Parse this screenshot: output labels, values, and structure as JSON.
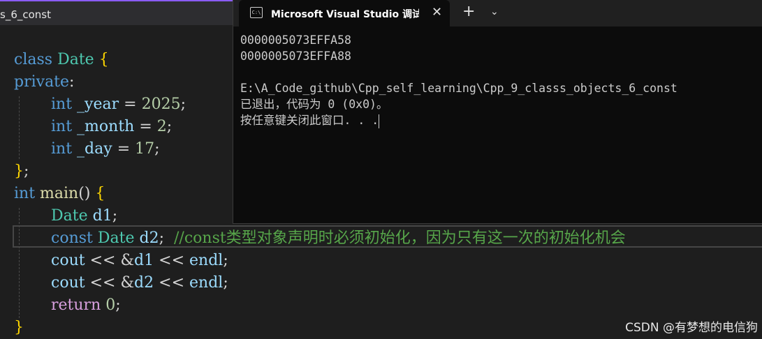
{
  "editor": {
    "tab_label": "s_6_const",
    "code": {
      "l1": {
        "kw": "class",
        "type": "Date",
        "brace": "{"
      },
      "l2": {
        "kw": "private",
        "colon": ":"
      },
      "l3": {
        "kw": "int",
        "var": "_year",
        "eq": "=",
        "num": "2025",
        "semi": ";"
      },
      "l4": {
        "kw": "int",
        "var": "_month",
        "eq": "=",
        "num": "2",
        "semi": ";"
      },
      "l5": {
        "kw": "int",
        "var": "_day",
        "eq": "=",
        "num": "17",
        "semi": ";"
      },
      "l6": {
        "brace": "}",
        "semi": ";"
      },
      "l7": {
        "kw": "int",
        "fn": "main",
        "parens": "()",
        "brace": "{"
      },
      "l8": {
        "type": "Date",
        "var": "d1",
        "semi": ";"
      },
      "l9": {
        "kw": "const",
        "type": "Date",
        "var": "d2",
        "semi": ";",
        "comment": "//const类型对象声明时必须初始化，因为只有这一次的初始化机会"
      },
      "l10": {
        "var": "cout",
        "op": "<<",
        "amp": "&",
        "var2": "d1",
        "op2": "<<",
        "var3": "endl",
        "semi": ";"
      },
      "l11": {
        "var": "cout",
        "op": "<<",
        "amp": "&",
        "var2": "d2",
        "op2": "<<",
        "var3": "endl",
        "semi": ";"
      },
      "l12": {
        "kw": "return",
        "num": "0",
        "semi": ";"
      },
      "l13": {
        "brace": "}"
      }
    }
  },
  "console": {
    "tab_title": "Microsoft Visual Studio 调试控制台",
    "icon_text": "C:\\",
    "close_glyph": "✕",
    "plus_glyph": "+",
    "chevron_glyph": "⌄",
    "lines": [
      "0000005073EFFA58",
      "0000005073EFFA88",
      "",
      "E:\\A_Code_github\\Cpp_self_learning\\Cpp_9_classs_objects_6_const",
      "已退出，代码为 0 (0x0)。",
      "按任意键关闭此窗口. . ."
    ]
  },
  "watermark": "CSDN @有梦想的电信狗",
  "colors": {
    "keyword": "#569cd6",
    "type": "#4ec9b0",
    "variable": "#9cdcfe",
    "number": "#b5cea8",
    "brace": "#ffd700",
    "comment": "#57a64a",
    "control": "#d8a0df",
    "function": "#dcdcaa"
  }
}
